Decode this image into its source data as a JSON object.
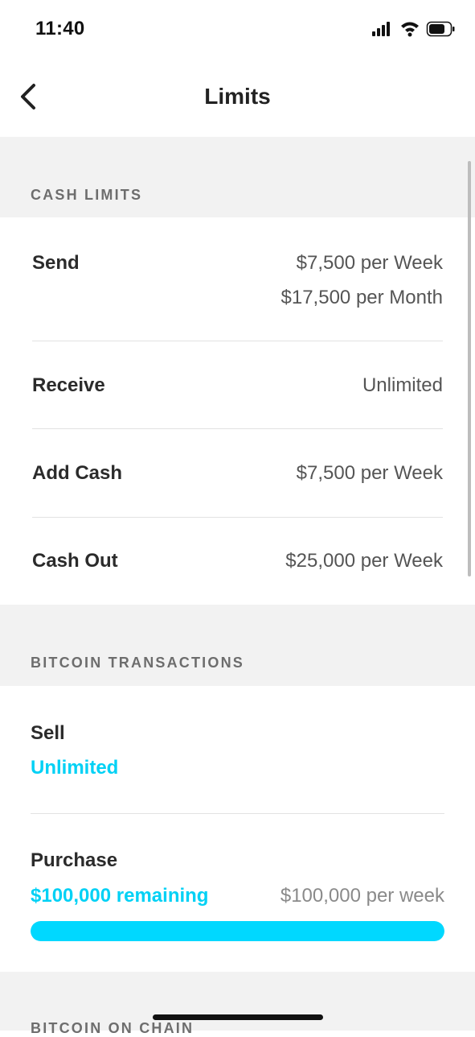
{
  "status_bar": {
    "time": "11:40"
  },
  "nav": {
    "title": "Limits"
  },
  "cash_limits": {
    "title": "CASH LIMITS",
    "send": {
      "label": "Send",
      "value_week": "$7,500 per Week",
      "value_month": "$17,500 per Month"
    },
    "receive": {
      "label": "Receive",
      "value": "Unlimited"
    },
    "add_cash": {
      "label": "Add Cash",
      "value": "$7,500 per Week"
    },
    "cash_out": {
      "label": "Cash Out",
      "value": "$25,000 per Week"
    }
  },
  "bitcoin_transactions": {
    "title": "BITCOIN TRANSACTIONS",
    "sell": {
      "label": "Sell",
      "value": "Unlimited"
    },
    "purchase": {
      "label": "Purchase",
      "remaining": "$100,000 remaining",
      "limit": "$100,000 per week",
      "progress_fraction": 1.0
    }
  },
  "bitcoin_on_chain": {
    "title": "BITCOIN ON CHAIN"
  },
  "colors": {
    "accent": "#00d1f5",
    "section_bg": "#f2f2f2",
    "text": "#2b2b2b",
    "muted": "#555555"
  },
  "icons": [
    "signal-icon",
    "wifi-icon",
    "battery-icon",
    "back-chevron-icon"
  ]
}
